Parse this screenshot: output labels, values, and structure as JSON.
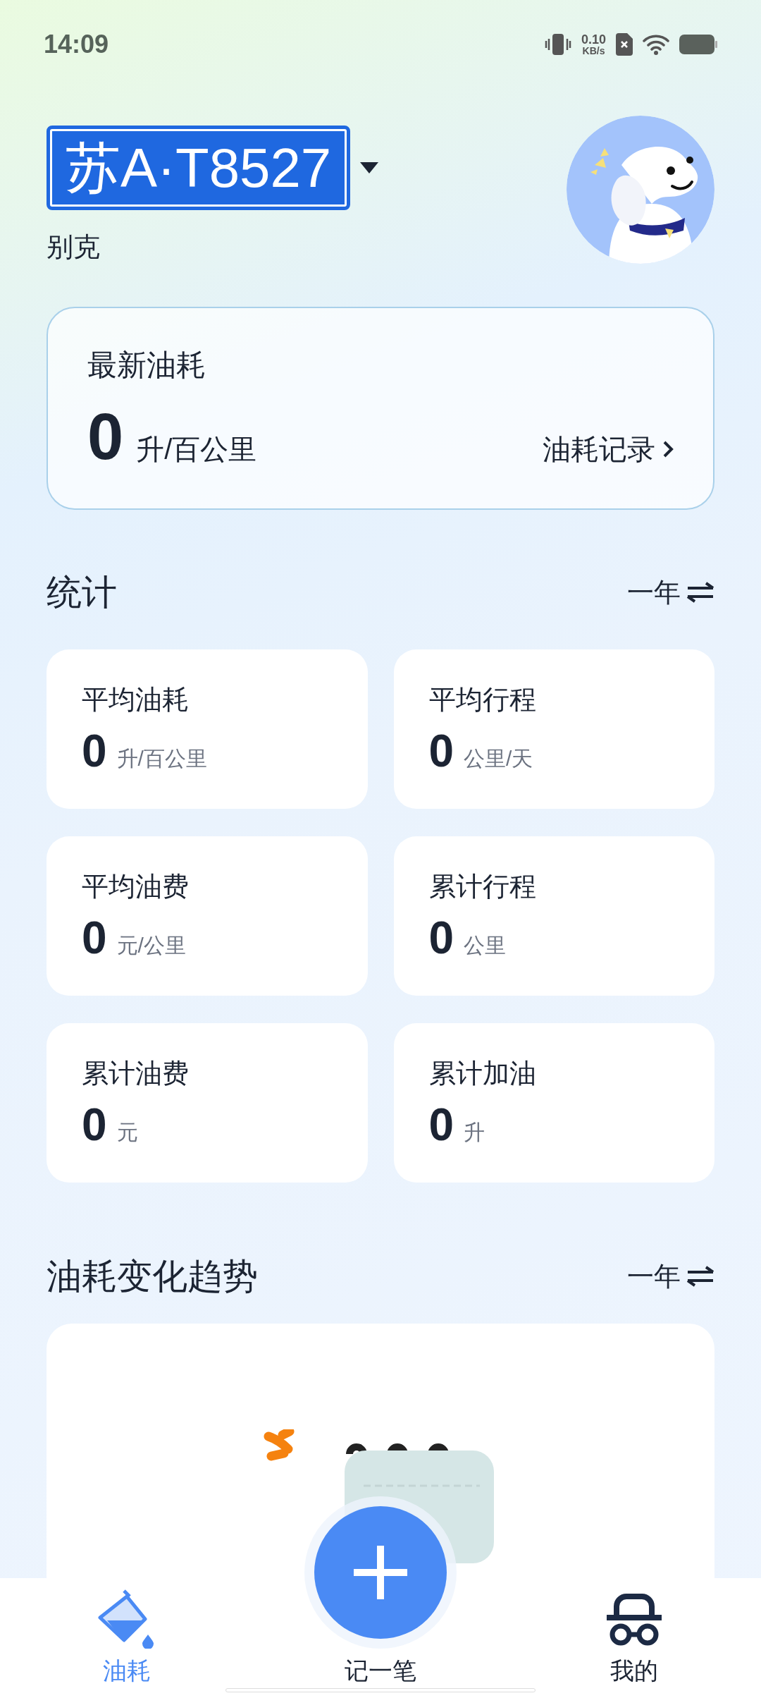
{
  "status_bar": {
    "time": "14:09",
    "net_speed": "0.10",
    "net_unit": "KB/s"
  },
  "vehicle": {
    "plate": "苏A·T8527",
    "brand": "别克"
  },
  "latest": {
    "title": "最新油耗",
    "value": "0",
    "unit": "升/百公里",
    "link": "油耗记录"
  },
  "stats": {
    "title": "统计",
    "period": "一年",
    "cards": [
      {
        "title": "平均油耗",
        "value": "0",
        "unit": "升/百公里"
      },
      {
        "title": "平均行程",
        "value": "0",
        "unit": "公里/天"
      },
      {
        "title": "平均油费",
        "value": "0",
        "unit": "元/公里"
      },
      {
        "title": "累计行程",
        "value": "0",
        "unit": "公里"
      },
      {
        "title": "累计油费",
        "value": "0",
        "unit": "元"
      },
      {
        "title": "累计加油",
        "value": "0",
        "unit": "升"
      }
    ]
  },
  "trend": {
    "title": "油耗变化趋势",
    "period": "一年"
  },
  "bottom_nav": [
    {
      "kind": "fuel",
      "label": "油耗",
      "selected": true
    },
    {
      "kind": "add",
      "label": "记一笔",
      "selected": false
    },
    {
      "kind": "profile",
      "label": "我的",
      "selected": false
    }
  ]
}
